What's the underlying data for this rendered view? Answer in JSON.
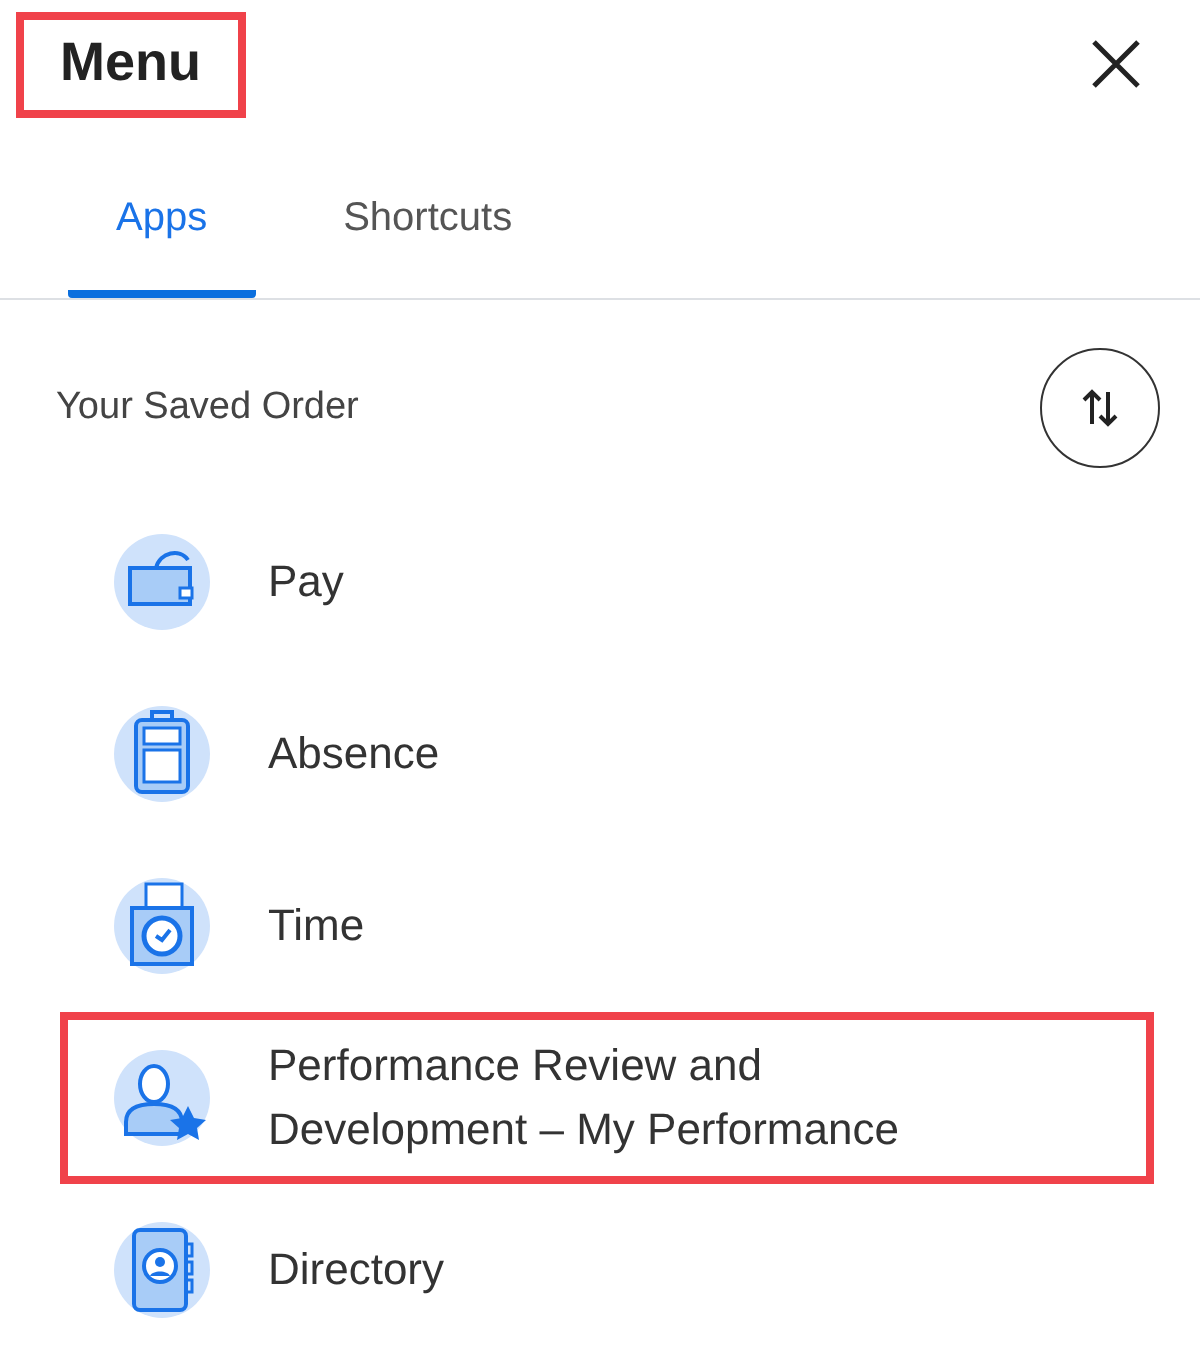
{
  "header": {
    "title": "Menu",
    "title_highlighted": true
  },
  "tabs": [
    {
      "label": "Apps",
      "selected": true
    },
    {
      "label": "Shortcuts",
      "selected": false
    }
  ],
  "section": {
    "label": "Your Saved Order"
  },
  "apps": [
    {
      "label": "Pay",
      "kind": "wallet",
      "highlighted": false
    },
    {
      "label": "Absence",
      "kind": "suitcase",
      "highlighted": false
    },
    {
      "label": "Time",
      "kind": "timeclock",
      "highlighted": false
    },
    {
      "label": "Performance Review and Development – My Performance",
      "kind": "person",
      "highlighted": true
    },
    {
      "label": "Directory",
      "kind": "book",
      "highlighted": false
    }
  ]
}
